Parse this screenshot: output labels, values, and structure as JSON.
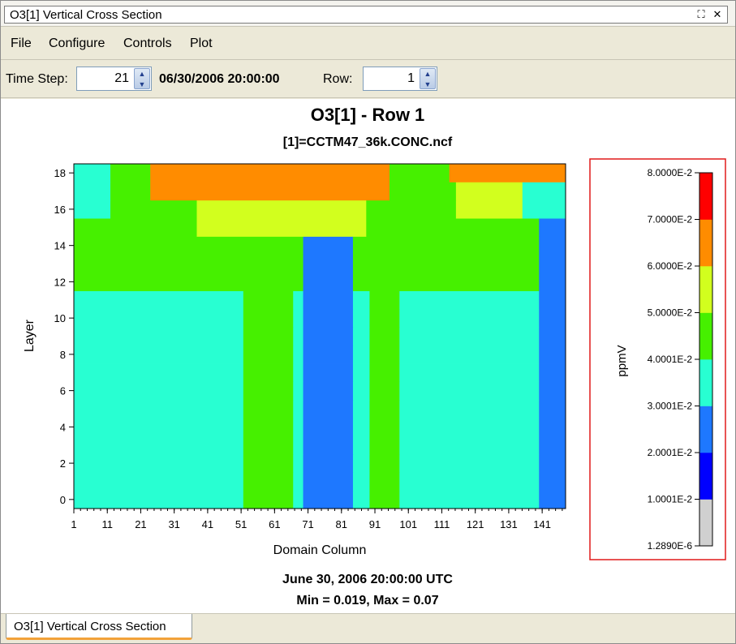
{
  "window": {
    "title": "O3[1] Vertical Cross Section"
  },
  "menu": {
    "items": [
      "File",
      "Configure",
      "Controls",
      "Plot"
    ]
  },
  "toolbar": {
    "time_step_label": "Time Step:",
    "time_step_value": "21",
    "datetime": "06/30/2006 20:00:00",
    "row_label": "Row:",
    "row_value": "1"
  },
  "plot": {
    "title": "O3[1] - Row 1",
    "subtitle": "[1]=CCTM47_36k.CONC.ncf",
    "footer_date": "June 30, 2006 20:00:00 UTC",
    "footer_stats": "Min = 0.019, Max = 0.07",
    "xlabel": "Domain Column",
    "ylabel": "Layer",
    "legend_unit": "ppmV"
  },
  "chart_data": {
    "type": "heatmap",
    "title": "O3[1] - Row 1",
    "subtitle": "[1]=CCTM47_36k.CONC.ncf",
    "xlabel": "Domain Column",
    "ylabel": "Layer",
    "x_ticks": [
      1,
      11,
      21,
      31,
      41,
      51,
      61,
      71,
      81,
      91,
      101,
      111,
      121,
      131,
      141
    ],
    "y_ticks": [
      0,
      2,
      4,
      6,
      8,
      10,
      12,
      14,
      16,
      18
    ],
    "xlim": [
      1,
      148
    ],
    "ylim": [
      -0.5,
      18.5
    ],
    "n_columns": 148,
    "n_layers": 19,
    "color_levels": [
      {
        "value": "1.2890E-6",
        "color": "#d0d0d0"
      },
      {
        "value": "1.0001E-2",
        "color": "#0000ff"
      },
      {
        "value": "2.0001E-2",
        "color": "#1e78ff"
      },
      {
        "value": "3.0001E-2",
        "color": "#28ffd2"
      },
      {
        "value": "4.0001E-2",
        "color": "#46f000"
      },
      {
        "value": "5.0000E-2",
        "color": "#d2ff1e"
      },
      {
        "value": "6.0000E-2",
        "color": "#ff8c00"
      },
      {
        "value": "7.0000E-2",
        "color": "#ff0000"
      },
      {
        "value": "8.0000E-2",
        "color": ""
      }
    ],
    "legend_unit": "ppmV",
    "min": 0.019,
    "max": 0.07,
    "cell_regions": [
      {
        "level": 3,
        "col_range": [
          1,
          148
        ],
        "layer_range": [
          0,
          18
        ]
      },
      {
        "level": 4,
        "col_range": [
          1,
          148
        ],
        "layer_range": [
          12,
          15
        ]
      },
      {
        "level": 4,
        "col_range": [
          52,
          66
        ],
        "layer_range": [
          0,
          11
        ]
      },
      {
        "level": 4,
        "col_range": [
          90,
          98
        ],
        "layer_range": [
          0,
          11
        ]
      },
      {
        "level": 2,
        "col_range": [
          70,
          84
        ],
        "layer_range": [
          0,
          15
        ]
      },
      {
        "level": 2,
        "col_range": [
          141,
          148
        ],
        "layer_range": [
          0,
          15
        ]
      },
      {
        "level": 4,
        "col_range": [
          12,
          132
        ],
        "layer_range": [
          16,
          18
        ]
      },
      {
        "level": 5,
        "col_range": [
          38,
          88
        ],
        "layer_range": [
          15,
          16
        ]
      },
      {
        "level": 5,
        "col_range": [
          116,
          135
        ],
        "layer_range": [
          16,
          17
        ]
      },
      {
        "level": 6,
        "col_range": [
          24,
          95
        ],
        "layer_range": [
          17,
          18
        ]
      },
      {
        "level": 6,
        "col_range": [
          114,
          148
        ],
        "layer_range": [
          18,
          18
        ]
      }
    ]
  }
}
